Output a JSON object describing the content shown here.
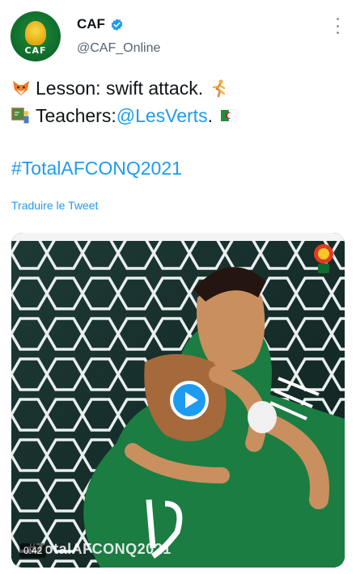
{
  "account": {
    "display_name": "CAF",
    "handle": "@CAF_Online",
    "avatar_text": "CAF"
  },
  "tweet": {
    "line1": {
      "emoji": "fox-emoji",
      "text": "Lesson: swift attack.",
      "emoji_after": "running-person-emoji"
    },
    "line2": {
      "emoji": "blackboard-emoji",
      "text_before": "Teachers: ",
      "mention": "@LesVerts",
      "text_after": ".",
      "emoji_after": "algeria-flag-emoji"
    },
    "hashtag": "#TotalAFCONQ2021",
    "translate_label": "Traduire le Tweet"
  },
  "media": {
    "duration": "0:42",
    "overlay_text": "#TotalAFCONQ2021",
    "play_icon": "play-icon",
    "badge_text": "CAF"
  },
  "colors": {
    "link": "#1d9bf0",
    "text": "#0f1419",
    "secondary": "#536471"
  }
}
